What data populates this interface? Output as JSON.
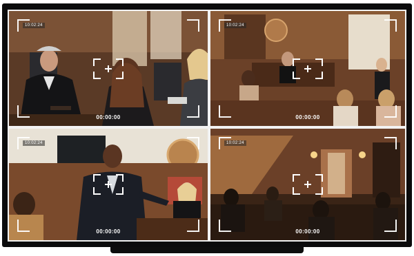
{
  "feeds": [
    {
      "id": "cam-1",
      "top_timecode": "10:02:24",
      "bottom_timecode": "00:00:00"
    },
    {
      "id": "cam-2",
      "top_timecode": "10:02:24",
      "bottom_timecode": "00:00:00"
    },
    {
      "id": "cam-3",
      "top_timecode": "10:02:24",
      "bottom_timecode": "00:00:00"
    },
    {
      "id": "cam-4",
      "top_timecode": "10:02:24",
      "bottom_timecode": "00:00:00"
    }
  ],
  "colors": {
    "bezel": "#0b0b0c",
    "overlay": "#ffffff",
    "wood_dark": "#4a2c1c",
    "wood_mid": "#7a4a2c",
    "wood_light": "#a8744a"
  }
}
